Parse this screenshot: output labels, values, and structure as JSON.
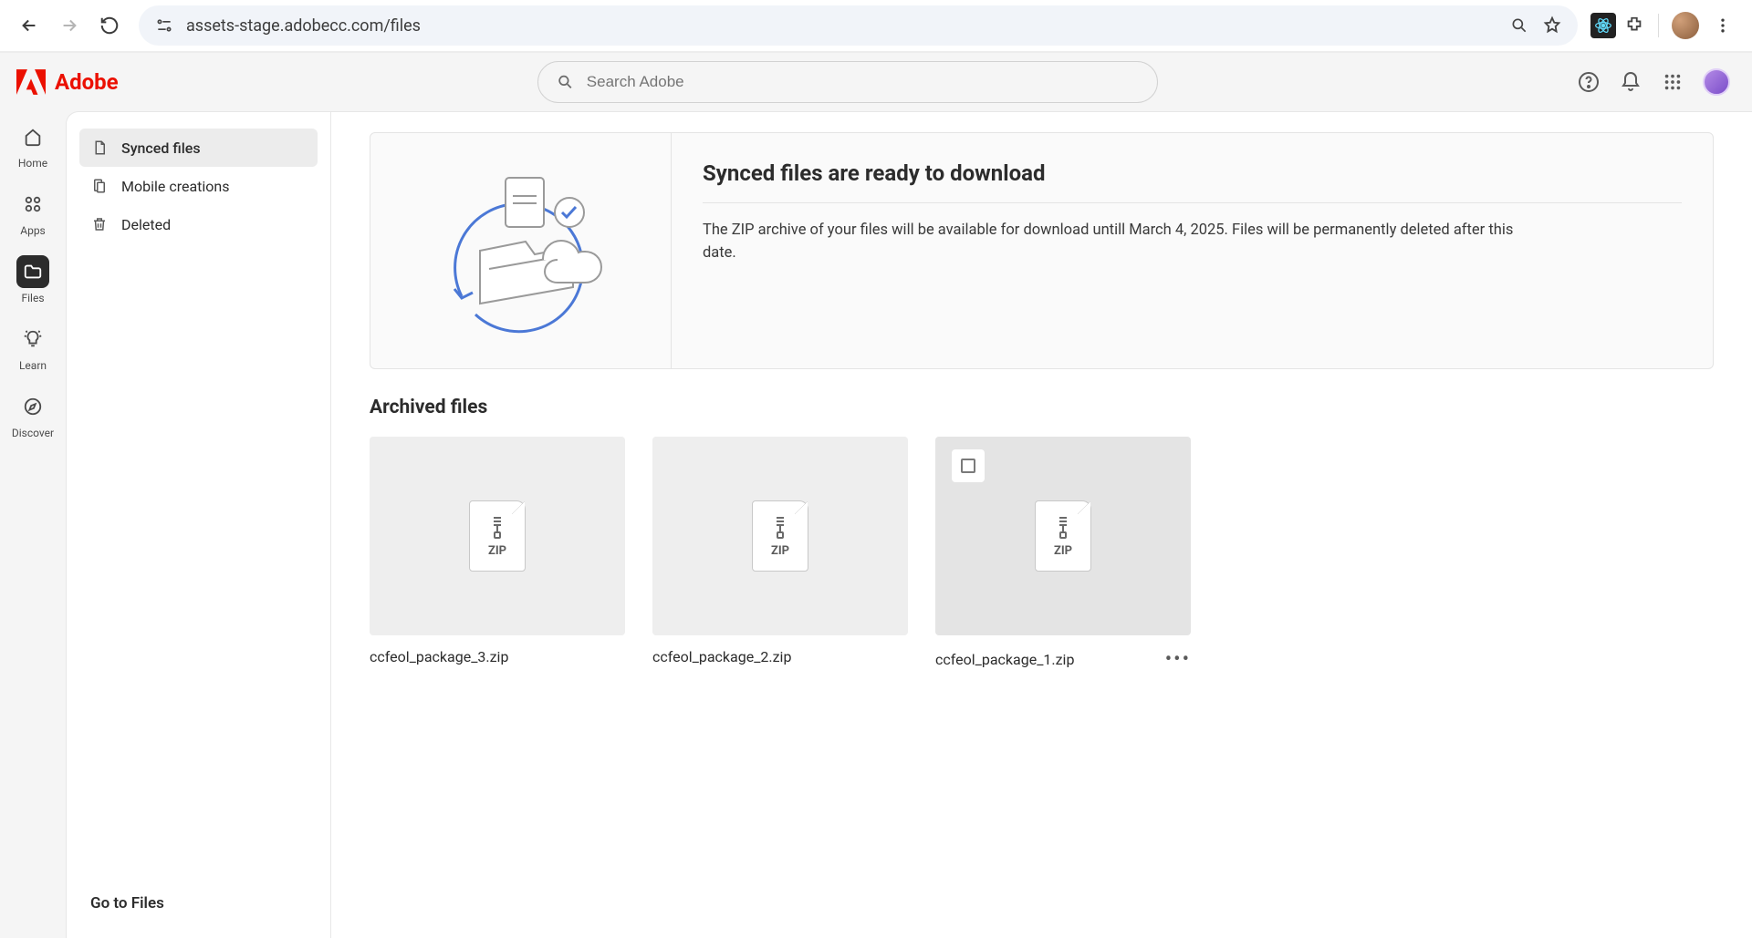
{
  "browser": {
    "url": "assets-stage.adobecc.com/files"
  },
  "header": {
    "brand": "Adobe",
    "search_placeholder": "Search Adobe"
  },
  "rail": [
    {
      "key": "home",
      "label": "Home"
    },
    {
      "key": "apps",
      "label": "Apps"
    },
    {
      "key": "files",
      "label": "Files"
    },
    {
      "key": "learn",
      "label": "Learn"
    },
    {
      "key": "discover",
      "label": "Discover"
    }
  ],
  "sidebar": {
    "items": [
      {
        "key": "synced",
        "label": "Synced files"
      },
      {
        "key": "mobile",
        "label": "Mobile creations"
      },
      {
        "key": "deleted",
        "label": "Deleted"
      }
    ],
    "footer_link": "Go to Files"
  },
  "banner": {
    "title": "Synced files are ready to download",
    "description": "The ZIP archive of your files will be available for download untill March 4, 2025. Files will be permanently deleted after this date."
  },
  "section": {
    "title": "Archived files",
    "files": [
      {
        "name": "ccfeol_package_3.zip",
        "type": "ZIP"
      },
      {
        "name": "ccfeol_package_2.zip",
        "type": "ZIP"
      },
      {
        "name": "ccfeol_package_1.zip",
        "type": "ZIP",
        "hovered": true
      }
    ]
  }
}
